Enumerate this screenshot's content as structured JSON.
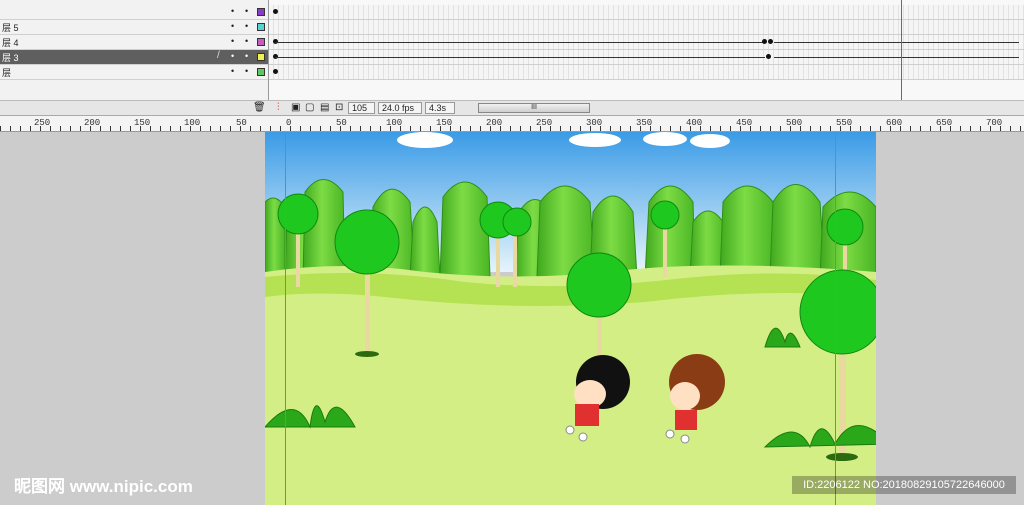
{
  "layers": [
    {
      "name": "",
      "color": "#8a3cc8",
      "selected": false,
      "pencil": false
    },
    {
      "name": "层 5",
      "color": "#5ad2d2",
      "selected": false,
      "pencil": false
    },
    {
      "name": "层 4",
      "color": "#c85ac8",
      "selected": false,
      "pencil": false
    },
    {
      "name": "层 3",
      "color": "#f0f050",
      "selected": true,
      "pencil": true
    },
    {
      "name": "层",
      "color": "#5ac85a",
      "selected": false,
      "pencil": false
    }
  ],
  "timeline_toolbar": {
    "current_frame": "105",
    "frame_rate": "24.0 fps",
    "elapsed_time": "4.3s",
    "scroll_grip": "III"
  },
  "ruler": {
    "labels": [
      "250",
      "200",
      "150",
      "100",
      "50",
      "0",
      "50",
      "100",
      "150",
      "200",
      "250",
      "300",
      "350",
      "400",
      "450",
      "500",
      "550",
      "600",
      "650",
      "700"
    ]
  },
  "icons": {
    "trash": "trash-icon",
    "onion_skin": "onion-skin-icon",
    "center_frame": "center-frame-icon"
  },
  "watermark": {
    "left": "昵图网 www.nipic.com",
    "right": "ID:2206122 NO:20180829105722646000"
  },
  "colors": {
    "sky_top": "#3a9be6",
    "grass": "#d4ee86",
    "hill": "#5fc532",
    "tree": "#1ec81e",
    "playhead": "#d04040",
    "guide": "#3ab83a"
  }
}
